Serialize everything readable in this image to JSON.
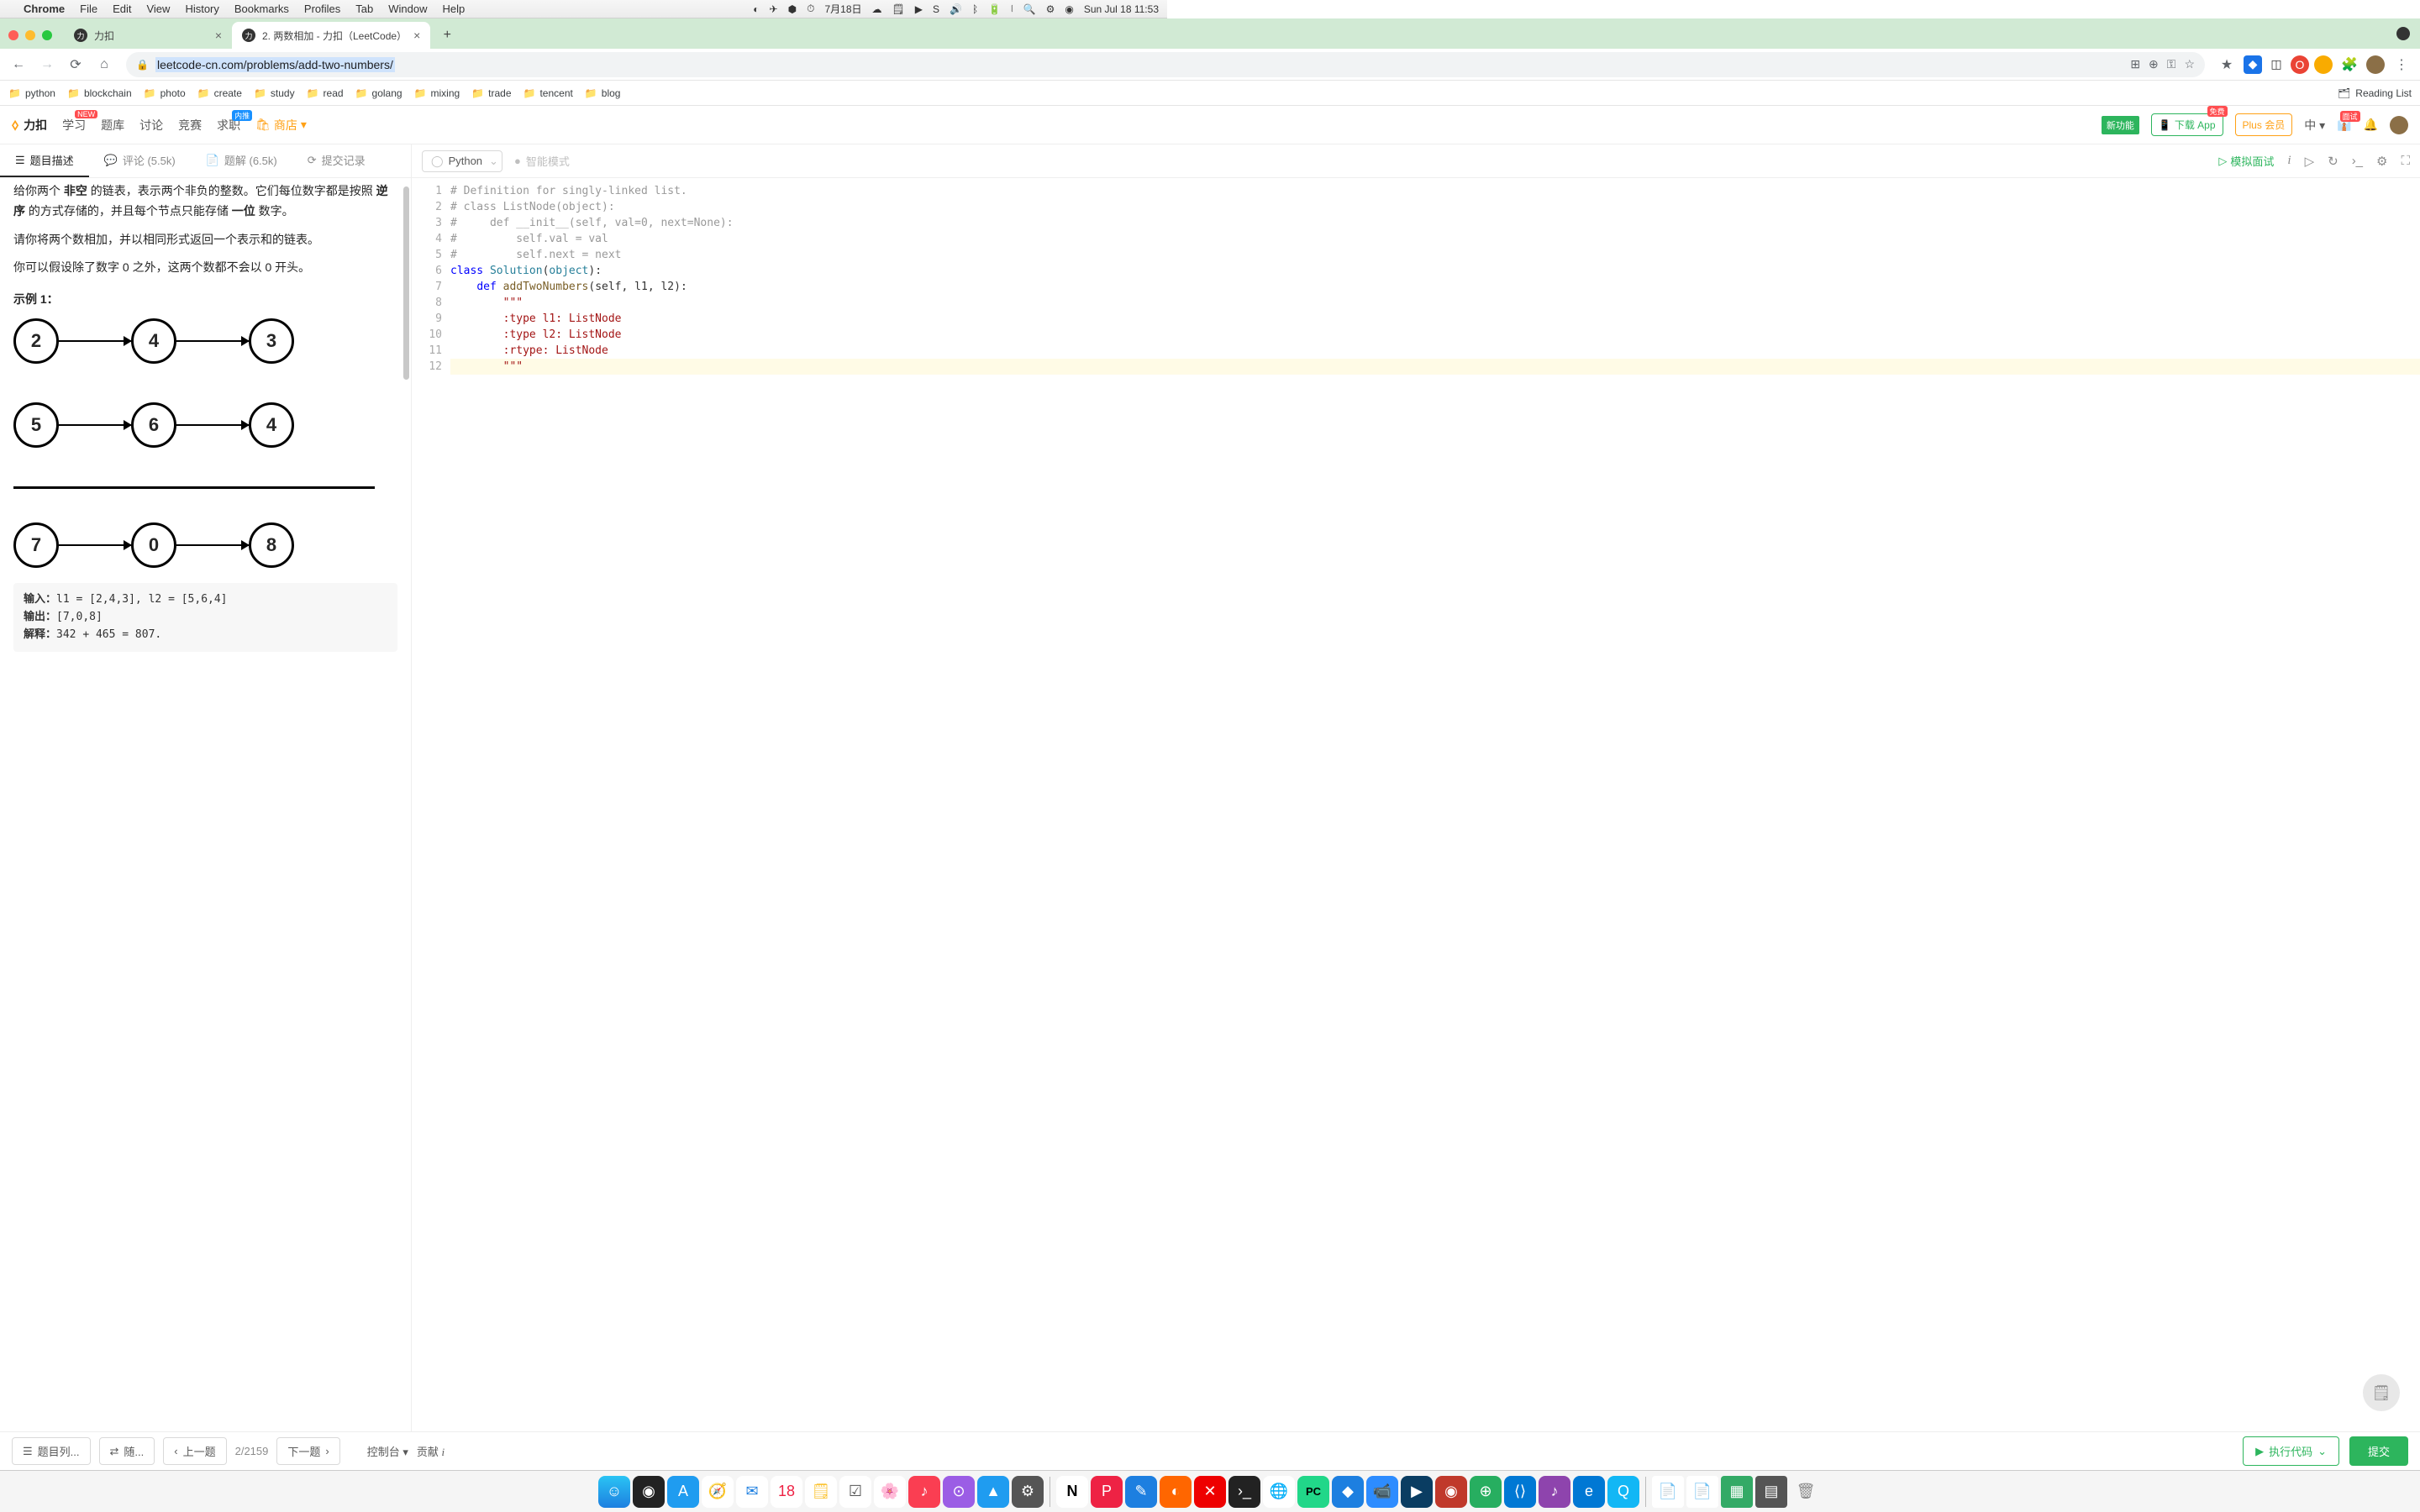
{
  "menubar": {
    "apple": "",
    "app": "Chrome",
    "items": [
      "File",
      "Edit",
      "View",
      "History",
      "Bookmarks",
      "Profiles",
      "Tab",
      "Window",
      "Help"
    ],
    "date_cn": "7月18日",
    "clock": "Sun Jul 18  11:53"
  },
  "tabs": [
    {
      "title": "力扣",
      "active": false
    },
    {
      "title": "2. 两数相加 - 力扣（LeetCode）",
      "active": true
    }
  ],
  "url": "leetcode-cn.com/problems/add-two-numbers/",
  "bookmarks": [
    "python",
    "blockchain",
    "photo",
    "create",
    "study",
    "read",
    "golang",
    "mixing",
    "trade",
    "tencent",
    "blog"
  ],
  "reading_list": "Reading List",
  "lc_nav": {
    "logo": "力扣",
    "items": [
      "学习",
      "题库",
      "讨论",
      "竞赛",
      "求职"
    ],
    "shop": "商店",
    "new_feature": "新功能",
    "download": "下载 App",
    "plus": "Plus 会员",
    "lang_btn": "中"
  },
  "problem_tabs": {
    "desc": "题目描述",
    "comments": "评论 (5.5k)",
    "solutions": "题解 (6.5k)",
    "submissions": "提交记录"
  },
  "editor_bar": {
    "language": "Python",
    "smart_mode": "智能模式",
    "mock": "模拟面试"
  },
  "description": {
    "p1_prefix": "给你两个 ",
    "p1_bold1": "非空",
    "p1_mid": " 的链表，表示两个非负的整数。它们每位数字都是按照 ",
    "p1_bold2": "逆序",
    "p1_tail": " 的方式存储的，并且每个节点只能存储 ",
    "p1_bold3": "一位",
    "p1_end": " 数字。",
    "p2": "请你将两个数相加，并以相同形式返回一个表示和的链表。",
    "p3": "你可以假设除了数字 0 之外，这两个数都不会以 0 开头。",
    "example_title": "示例 1：",
    "ll1": [
      "2",
      "4",
      "3"
    ],
    "ll2": [
      "5",
      "6",
      "4"
    ],
    "ll3": [
      "7",
      "0",
      "8"
    ],
    "input_label": "输入：",
    "input_val": "l1 = [2,4,3], l2 = [5,6,4]",
    "output_label": "输出：",
    "output_val": "[7,0,8]",
    "explain_label": "解释：",
    "explain_val": "342 + 465 = 807."
  },
  "code": {
    "lines": [
      "# Definition for singly-linked list.",
      "# class ListNode(object):",
      "#     def __init__(self, val=0, next=None):",
      "#         self.val = val",
      "#         self.next = next",
      "class Solution(object):",
      "    def addTwoNumbers(self, l1, l2):",
      "        \"\"\"",
      "        :type l1: ListNode",
      "        :type l2: ListNode",
      "        :rtype: ListNode",
      "        \"\"\""
    ]
  },
  "bottom": {
    "list": "题目列...",
    "random": "随...",
    "prev": "上一题",
    "counter": "2/2159",
    "next": "下一题",
    "console": "控制台",
    "contribute": "贡献",
    "run": "执行代码",
    "submit": "提交"
  },
  "colors": {
    "green": "#2db55d",
    "orange": "#ffa116"
  }
}
